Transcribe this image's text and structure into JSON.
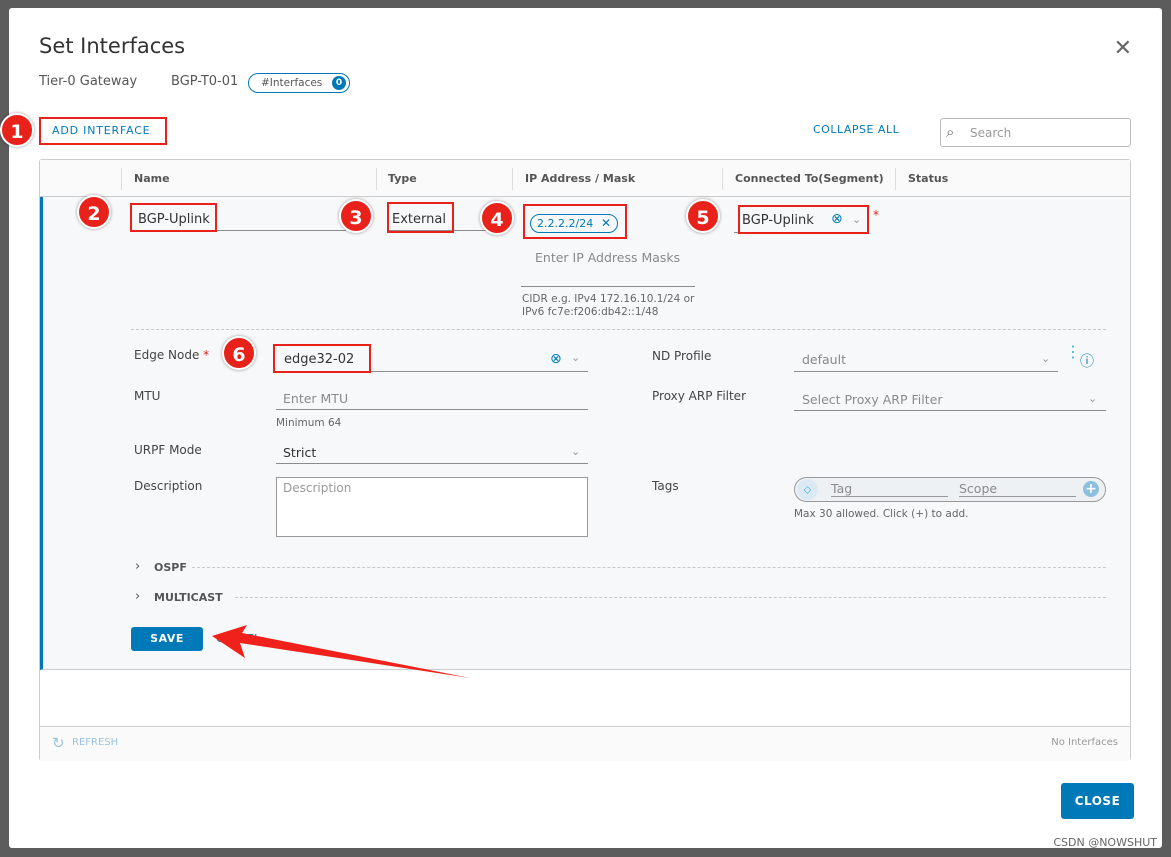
{
  "dialog": {
    "title": "Set Interfaces",
    "gateway_label": "Tier-0 Gateway",
    "gateway_name": "BGP-T0-01",
    "interfaces_pill": "#Interfaces",
    "interfaces_count": "0"
  },
  "toolbar": {
    "add_interface": "ADD INTERFACE",
    "collapse_all": "COLLAPSE ALL",
    "search_placeholder": "Search"
  },
  "table": {
    "columns": [
      "Name",
      "Type",
      "IP Address / Mask",
      "Connected To(Segment)",
      "Status"
    ]
  },
  "row": {
    "name": "BGP-Uplink",
    "type": "External",
    "ip_chip": "2.2.2.2/24",
    "ip_placeholder": "Enter IP Address Masks",
    "ip_help_1": "CIDR e.g. IPv4 172.16.10.1/24 or",
    "ip_help_2": "IPv6 fc7e:f206:db42::1/48",
    "segment": "BGP-Uplink"
  },
  "form": {
    "edge_node_label": "Edge Node",
    "edge_node_value": "edge32-02",
    "mtu_label": "MTU",
    "mtu_placeholder": "Enter MTU",
    "mtu_help": "Minimum 64",
    "urpf_label": "URPF Mode",
    "urpf_value": "Strict",
    "description_label": "Description",
    "description_placeholder": "Description",
    "nd_profile_label": "ND Profile",
    "nd_profile_value": "default",
    "proxy_arp_label": "Proxy ARP Filter",
    "proxy_arp_placeholder": "Select Proxy ARP Filter",
    "tags_label": "Tags",
    "tag_placeholder": "Tag",
    "scope_placeholder": "Scope",
    "tags_help": "Max 30 allowed. Click (+) to add.",
    "ospf": "OSPF",
    "multicast": "MULTICAST",
    "save": "SAVE",
    "cancel": "CANCEL"
  },
  "footer": {
    "refresh": "REFRESH",
    "no_interfaces": "No Interfaces",
    "close": "CLOSE"
  },
  "annotations": [
    "1",
    "2",
    "3",
    "4",
    "5",
    "6"
  ],
  "watermark": "CSDN @NOWSHUT",
  "colors": {
    "accent": "#0079b8",
    "annotation": "#e8221a"
  }
}
